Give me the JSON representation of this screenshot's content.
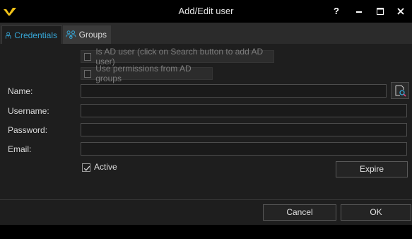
{
  "window": {
    "title": "Add/Edit user",
    "help_glyph": "?",
    "icons": [
      "app-logo-icon",
      "help-icon",
      "minimize-icon",
      "maximize-icon",
      "close-icon"
    ]
  },
  "tabs": [
    {
      "label": "Credentials",
      "icon": "user-icon",
      "selected": true
    },
    {
      "label": "Groups",
      "icon": "users-group-icon",
      "selected": false
    }
  ],
  "form": {
    "is_ad_user": {
      "label": "Is AD user (click on Search button to add AD user)",
      "checked": false,
      "enabled": false
    },
    "use_ad_permissions": {
      "label": "Use permissions from AD groups",
      "checked": false,
      "enabled": false
    },
    "name": {
      "label": "Name:",
      "value": ""
    },
    "username": {
      "label": "Username:",
      "value": ""
    },
    "password": {
      "label": "Password:",
      "value": ""
    },
    "email": {
      "label": "Email:",
      "value": ""
    },
    "active": {
      "label": "Active",
      "checked": true
    },
    "search_icon": "search-user-icon",
    "expire_label": "Expire"
  },
  "footer": {
    "cancel_label": "Cancel",
    "ok_label": "OK"
  },
  "colors": {
    "accent": "#36a6d6",
    "logo": "#f2c318",
    "background": "#1e1e1e",
    "titlebar": "#000000"
  }
}
